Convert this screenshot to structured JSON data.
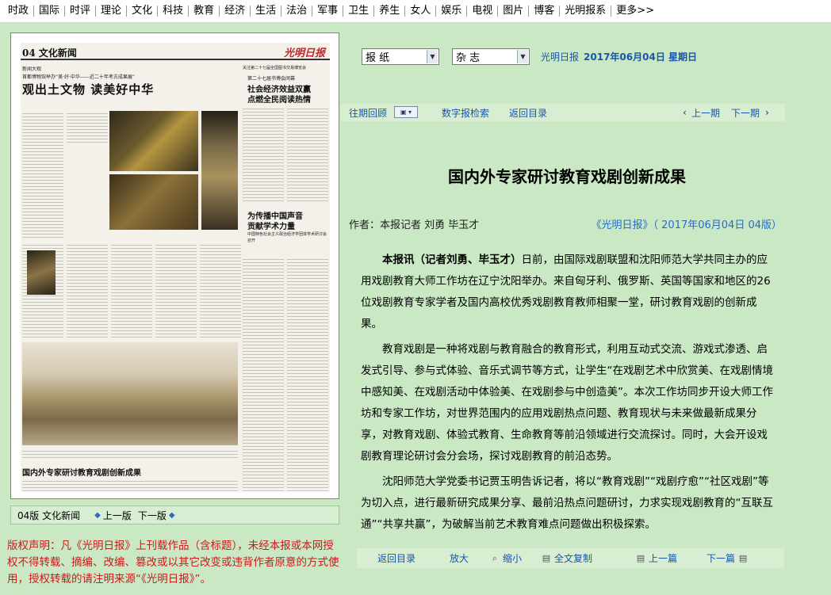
{
  "nav": {
    "items": [
      "时政",
      "国际",
      "时评",
      "理论",
      "文化",
      "科技",
      "教育",
      "经济",
      "生活",
      "法治",
      "军事",
      "卫生",
      "养生",
      "女人",
      "娱乐",
      "电视",
      "图片",
      "博客",
      "光明报系",
      "更多>>"
    ]
  },
  "paper": {
    "page_label": "04 文化新闻",
    "masthead": "光明日报",
    "section1": "新闻大观",
    "kicker1": "首都博物馆举办“美·好·中华——近二十年考古成果展”",
    "headline1": "观出土文物 读美好中华",
    "section2": "关注第二十七届全国图书交易博览会",
    "kicker2": "第二十七届书博会闭幕",
    "headline2a": "社会经济效益双赢",
    "headline2b": "点燃全民阅读热情",
    "headline3a": "为传播中国声音",
    "headline3b": "贡献学术力量",
    "sub3": "中国特色社会主义政治经济学团体学术研讨会召开",
    "headline4": "国内外专家研讨教育戏剧创新成果"
  },
  "page_bar": {
    "edition": "04版 文化新闻",
    "prev": "上一版",
    "next": "下一版"
  },
  "copyright": "版权声明：凡《光明日报》上刊载作品（含标题），未经本报或本网授权不得转载、摘编、改编、篡改或以其它改变或违背作者原意的方式使用，授权转载的请注明来源“《光明日报》”。",
  "selects": {
    "paper": "报 纸",
    "magazine": "杂 志"
  },
  "date_info": {
    "paper_name": "光明日报",
    "date": "2017年06月04日  星期日"
  },
  "subnav": {
    "past": "往期回顾",
    "digital": "数字报检索",
    "back": "返回目录",
    "prev_issue": "上一期",
    "next_issue": "下一期"
  },
  "article": {
    "title": "国内外专家研讨教育戏剧创新成果",
    "byline": "作者：本报记者 刘勇 毕玉才",
    "source": "《光明日报》（ 2017年06月04日 04版）",
    "lead_bold": "本报讯（记者刘勇、毕玉才）",
    "p1": "日前，由国际戏剧联盟和沈阳师范大学共同主办的应用戏剧教育大师工作坊在辽宁沈阳举办。来自匈牙利、俄罗斯、英国等国家和地区的26位戏剧教育专家学者及国内高校优秀戏剧教育教师相聚一堂，研讨教育戏剧的创新成果。",
    "p2": "教育戏剧是一种将戏剧与教育融合的教育形式，利用互动式交流、游戏式渗透、启发式引导、参与式体验、音乐式调节等方式，让学生“在戏剧艺术中欣赏美、在戏剧情境中感知美、在戏剧活动中体验美、在戏剧参与中创造美”。本次工作坊同步开设大师工作坊和专家工作坊，对世界范围内的应用戏剧热点问题、教育现状与未来做最新成果分享，对教育戏剧、体验式教育、生命教育等前沿领域进行交流探讨。同时，大会开设戏剧教育理论研讨会分会场，探讨戏剧教育的前沿态势。",
    "p3": "沈阳师范大学党委书记贾玉明告诉记者，将以“教育戏剧”“戏剧疗愈”“社区戏剧”等为切入点，进行最新研究成果分享、最前沿热点问题研讨，力求实现戏剧教育的“互联互通”“共享共赢”，为破解当前艺术教育难点问题做出积极探索。"
  },
  "toolbar": {
    "back": "返回目录",
    "zoom_in": "放大",
    "zoom_out": "缩小",
    "copy": "全文复制",
    "prev": "上一篇",
    "next": "下一篇"
  }
}
